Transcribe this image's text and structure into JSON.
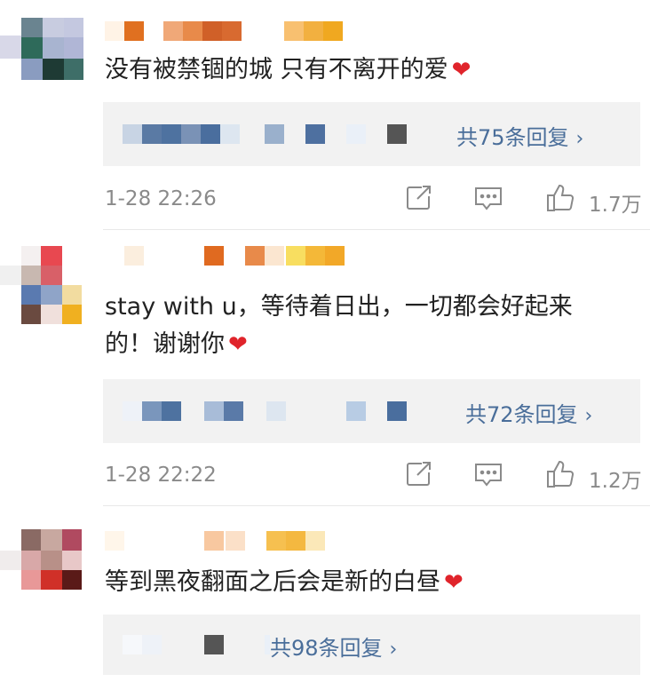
{
  "comments": [
    {
      "text": "没有被禁锢的城 只有不离开的爱",
      "heart": "❤",
      "reply_link": "共75条回复",
      "chevron": "›",
      "timestamp": "1-28 22:26",
      "like_count": "1.7万"
    },
    {
      "text_line1": "stay with u，等待着日出，一切都会好起来",
      "text_line2": "的！谢谢你",
      "heart": "❤",
      "reply_link": "共72条回复",
      "chevron": "›",
      "timestamp": "1-28 22:22",
      "like_count": "1.2万"
    },
    {
      "text": "等到黑夜翻面之后会是新的白昼",
      "heart": "❤",
      "reply_link": "共98条回复",
      "chevron": "›"
    }
  ],
  "colors": {
    "link": "#4a6e9a",
    "heart": "#e0242b",
    "reply_bg": "#f2f2f2",
    "meta_text": "#8a8a8a"
  },
  "icons": [
    "share-icon",
    "comment-icon",
    "like-icon"
  ]
}
